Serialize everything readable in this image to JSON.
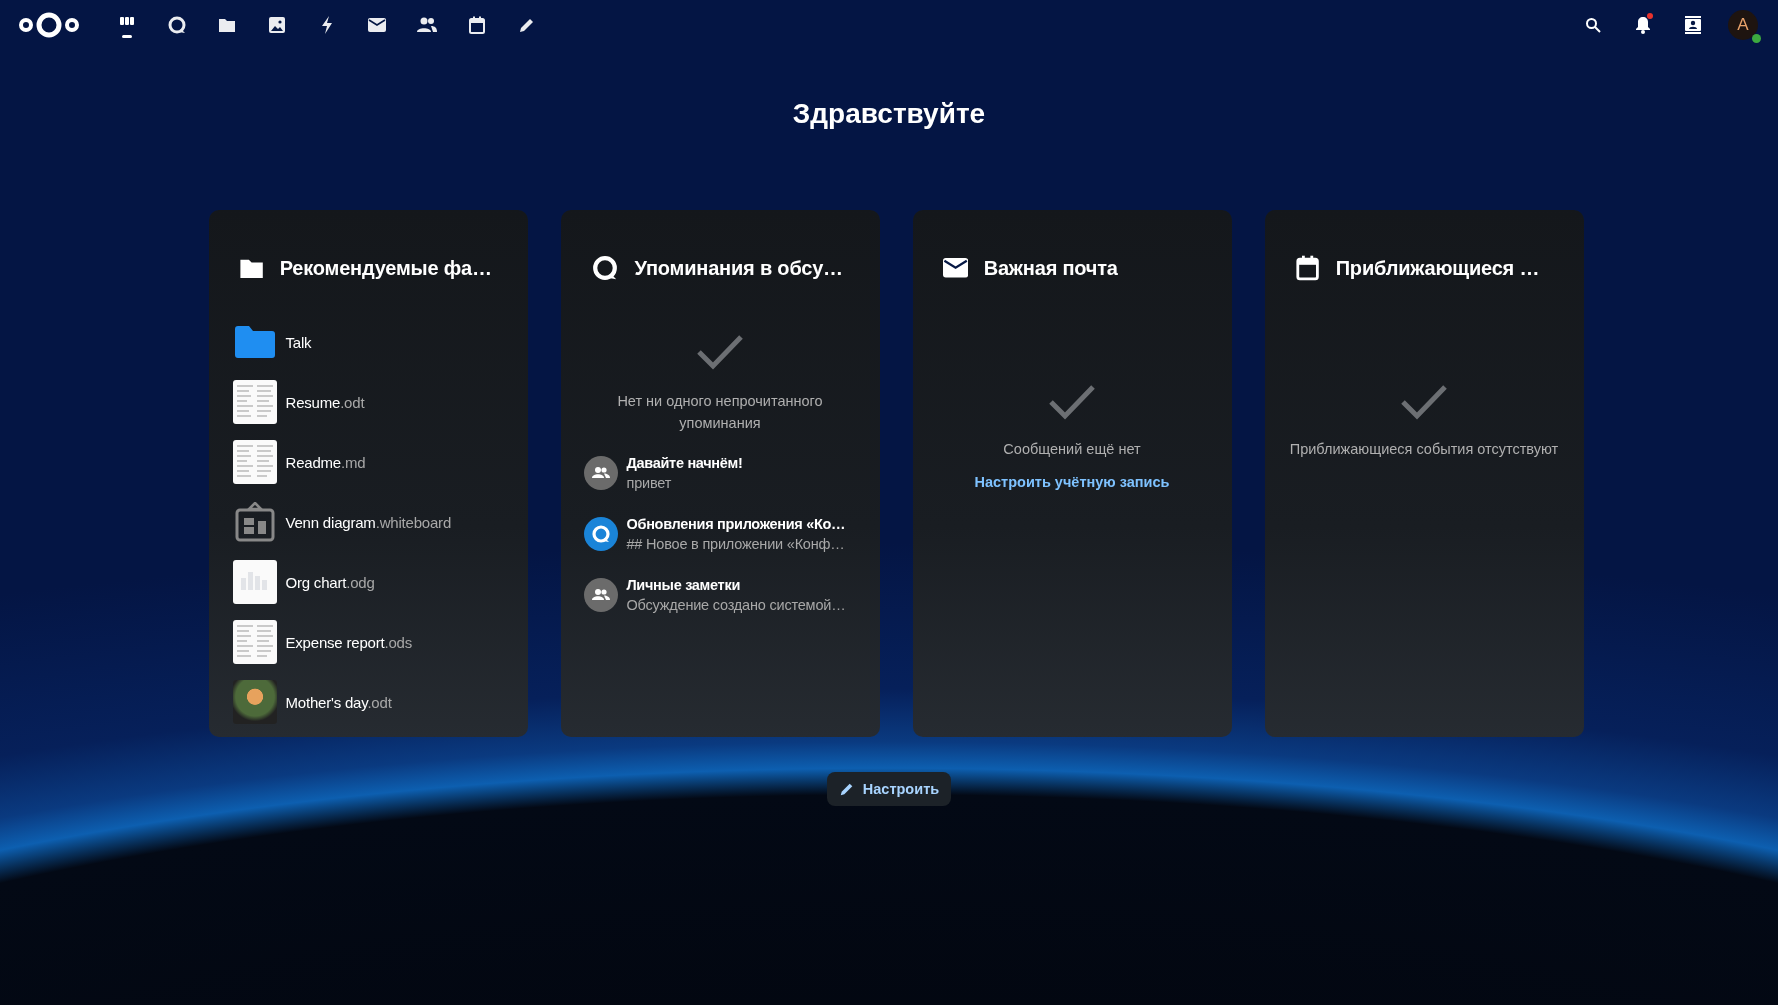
{
  "header": {
    "apps": [
      {
        "kind": "dashboard",
        "selected": true
      },
      {
        "kind": "talk",
        "selected": false
      },
      {
        "kind": "files",
        "selected": false
      },
      {
        "kind": "photos",
        "selected": false
      },
      {
        "kind": "activity",
        "selected": false
      },
      {
        "kind": "mail",
        "selected": false
      },
      {
        "kind": "contacts",
        "selected": false
      },
      {
        "kind": "calendar",
        "selected": false
      },
      {
        "kind": "notes",
        "selected": false
      }
    ],
    "notifications": {
      "unread": true
    },
    "avatar": {
      "initial": "A",
      "online": true
    }
  },
  "greeting": "Здравствуйте",
  "widgets": [
    {
      "kind": "files",
      "title": "Рекомендуемые фа…",
      "items": [
        {
          "name": "Talk",
          "kind": "folder"
        },
        {
          "name": "Resume",
          "ext": ".odt",
          "kind": "document"
        },
        {
          "name": "Readme",
          "ext": ".md",
          "kind": "document"
        },
        {
          "name": "Venn diagram",
          "ext": ".whiteboard",
          "kind": "whiteboard"
        },
        {
          "name": "Org chart",
          "ext": ".odg",
          "kind": "chart"
        },
        {
          "name": "Expense report",
          "ext": ".ods",
          "kind": "document"
        },
        {
          "name": "Mother's day",
          "ext": ".odt",
          "kind": "photo"
        }
      ]
    },
    {
      "kind": "talk",
      "title": "Упоминания в обсу…",
      "empty_message": "Нет ни одного непрочитанного упоминания",
      "items": [
        {
          "title": "Давайте начнём!",
          "subtitle": "привет",
          "kind": "group"
        },
        {
          "title": "Обновления приложения «Ко…",
          "subtitle": "## Новое в приложении «Конф…",
          "kind": "talk"
        },
        {
          "title": "Личные заметки",
          "subtitle": "Обсуждение создано системой…",
          "kind": "group"
        }
      ]
    },
    {
      "kind": "mail",
      "title": "Важная почта",
      "empty_message": "Сообщений ещё нет",
      "action": "Настроить учётную запись"
    },
    {
      "kind": "calendar",
      "title": "Приближающиеся …",
      "empty_message": "Приближающиеся события отсутствуют"
    }
  ],
  "customize_button": "Настроить"
}
